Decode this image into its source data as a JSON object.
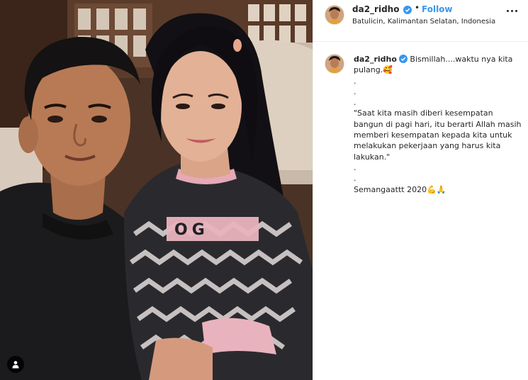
{
  "post": {
    "username": "da2_ridho",
    "verified": true,
    "follow_label": "Follow",
    "separator": "•",
    "location": "Batulicin, Kalimantan Selatan, Indonesia"
  },
  "caption": {
    "username": "da2_ridho",
    "first_line": "Bismillah....waktu nya kita pulang.",
    "first_emoji": "🥰",
    "dots": [
      ".",
      ".",
      "."
    ],
    "quote": "\"Saat kita masih diberi kesempatan bangun di pagi hari, itu berarti Allah masih memberi kesempatan kepada kita untuk melakukan pekerjaan yang harus kita lakukan.\"",
    "dots2": [
      ".",
      "."
    ],
    "closing": "Semangaattt 2020",
    "closing_emoji": "💪🙏"
  },
  "photo": {
    "sweater_text": "OG"
  },
  "colors": {
    "accent": "#3897f0",
    "text": "#262626",
    "border": "#efefef",
    "sweater_pink": "#e9b3be"
  }
}
